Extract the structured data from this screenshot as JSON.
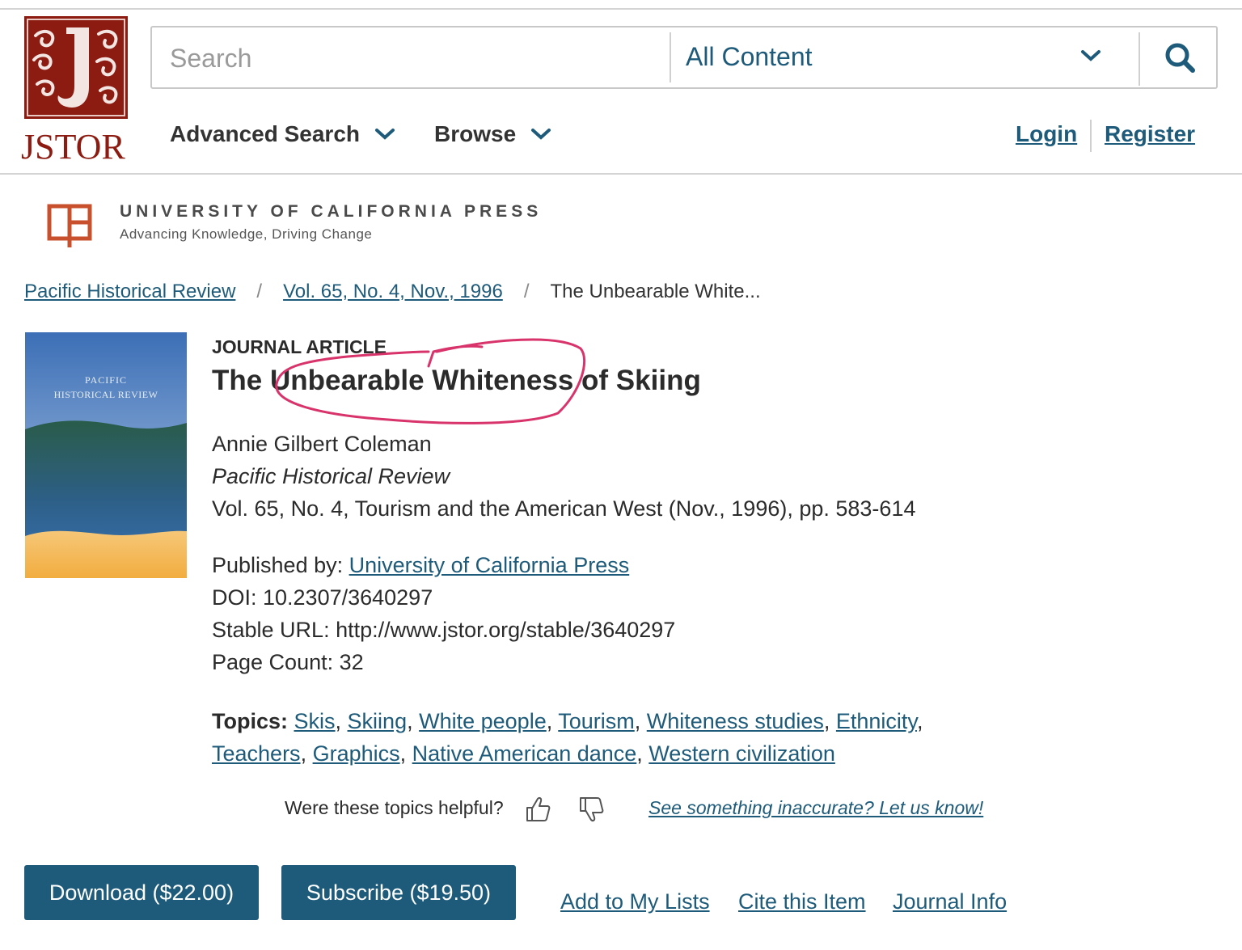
{
  "header": {
    "logo_text": "JSTOR",
    "search": {
      "placeholder": "Search",
      "value": ""
    },
    "content_select": {
      "selected": "All Content"
    },
    "nav": {
      "advanced_search": "Advanced Search",
      "browse": "Browse"
    },
    "auth": {
      "login": "Login",
      "register": "Register"
    }
  },
  "publisher": {
    "name": "UNIVERSITY OF CALIFORNIA PRESS",
    "tagline": "Advancing Knowledge, Driving Change"
  },
  "breadcrumb": [
    {
      "label": "Pacific Historical Review",
      "link": true
    },
    {
      "label": "Vol. 65, No. 4, Nov., 1996",
      "link": true
    },
    {
      "label": "The Unbearable White...",
      "link": false
    }
  ],
  "cover": {
    "line1": "PACIFIC",
    "line2": "HISTORICAL REVIEW"
  },
  "article": {
    "type": "JOURNAL ARTICLE",
    "title": "The Unbearable Whiteness of Skiing",
    "author": "Annie Gilbert Coleman",
    "journal": "Pacific Historical Review",
    "issue": "Vol. 65, No. 4, Tourism and the American West (Nov., 1996), pp. 583-614",
    "published_by_label": "Published by: ",
    "publisher": "University of California Press",
    "doi": "DOI: 10.2307/3640297",
    "stable_url": "Stable URL: http://www.jstor.org/stable/3640297",
    "page_count": "Page Count: 32"
  },
  "topics": {
    "label": "Topics:",
    "items": [
      "Skis",
      "Skiing",
      "White people",
      "Tourism",
      "Whiteness studies",
      "Ethnicity",
      "Teachers",
      "Graphics",
      "Native American dance",
      "Western civilization"
    ]
  },
  "feedback": {
    "question": "Were these topics helpful?",
    "report": "See something inaccurate? Let us know!"
  },
  "actions": {
    "download": "Download ($22.00)",
    "subscribe": "Subscribe ($19.50)",
    "add_to_lists": "Add to My Lists",
    "cite": "Cite this Item",
    "journal_info": "Journal Info"
  },
  "colors": {
    "brand_red": "#8c1b12",
    "link_blue": "#1e5b7a",
    "annotation": "#d9336b"
  }
}
